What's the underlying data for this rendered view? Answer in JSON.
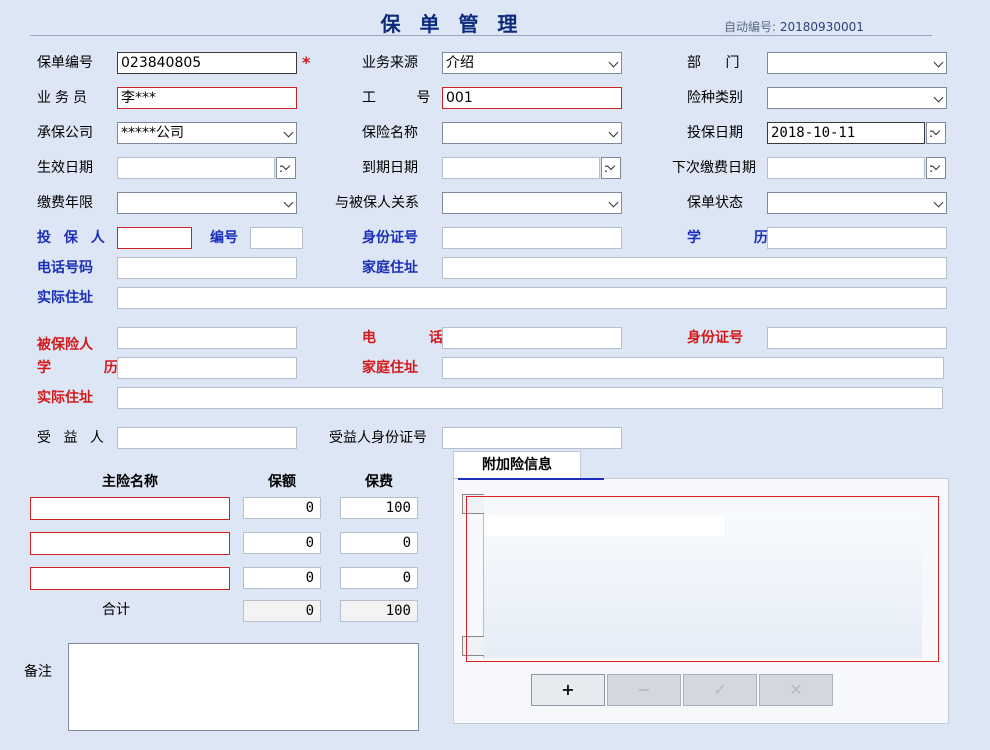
{
  "window": {
    "title": "保 单 管 理"
  },
  "auto_number": {
    "label": "自动编号:",
    "value": "20180930001"
  },
  "labels": {
    "policy_no": "保单编号",
    "biz_source": "业务来源",
    "department": "部 门",
    "agent": "业务员",
    "job_no": "工 号",
    "insurance_type": "险种类别",
    "insurer": "承保公司",
    "insurance_name": "保险名称",
    "apply_date": "投保日期",
    "effective_date": "生效日期",
    "expiry_date": "到期日期",
    "next_payment_date": "下次缴费日期",
    "payment_years": "缴费年限",
    "relation": "与被保人关系",
    "policy_status": "保单状态",
    "policyholder": "投 保 人",
    "code": "编号",
    "id_no": "身份证号",
    "education": "学 历",
    "phone": "电话号码",
    "home_addr": "家庭住址",
    "actual_addr": "实际住址",
    "insured": "被保险人",
    "ins_phone": "电 话",
    "ins_id": "身份证号",
    "ins_edu": "学 历",
    "ins_home": "家庭住址",
    "ins_actual": "实际住址",
    "beneficiary": "受 益 人",
    "beneficiary_id": "受益人身份证号",
    "main_name": "主险名称",
    "coverage": "保额",
    "premium": "保费",
    "total": "合计",
    "memo": "备注",
    "required_mark": "*"
  },
  "values": {
    "policy_no": "023840805",
    "biz_source": "介绍",
    "agent": "李***",
    "job_no": "001",
    "insurer": "*****公司",
    "apply_date": "2018-10-11"
  },
  "main_rows": [
    {
      "name": "",
      "coverage": "0",
      "premium": "100"
    },
    {
      "name": "",
      "coverage": "0",
      "premium": "0"
    },
    {
      "name": "",
      "coverage": "0",
      "premium": "0"
    }
  ],
  "totals": {
    "coverage": "0",
    "premium": "100"
  },
  "tab": {
    "label": "附加险信息"
  },
  "buttons": {
    "add": "+",
    "remove": "−",
    "confirm": "✓",
    "cancel": "✕"
  }
}
